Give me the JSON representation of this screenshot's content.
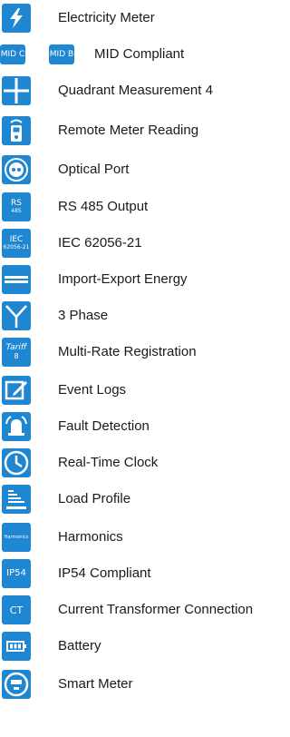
{
  "features": [
    {
      "label": "Electricity Meter",
      "icon": "lightning-icon"
    },
    {
      "label": "MID Compliant",
      "icon": "mid-badge-icon",
      "badges": [
        "MID C",
        "MID B"
      ]
    },
    {
      "label": "Quadrant Measurement 4",
      "icon": "quadrant-icon"
    },
    {
      "label": "Remote Meter Reading",
      "icon": "remote-reader-icon"
    },
    {
      "label": "Optical Port",
      "icon": "optical-port-icon"
    },
    {
      "label": "RS 485 Output",
      "icon": "rs485-icon",
      "badge": [
        "RS",
        "485"
      ]
    },
    {
      "label": "IEC 62056-21",
      "icon": "iec-icon",
      "badge": [
        "IEC",
        "62056-21"
      ]
    },
    {
      "label": "Import-Export Energy",
      "icon": "import-export-icon"
    },
    {
      "label": "3 Phase",
      "icon": "three-phase-icon"
    },
    {
      "label": "Multi-Rate Registration",
      "icon": "tariff-icon",
      "badge": [
        "Tariff",
        "8"
      ]
    },
    {
      "label": "Event Logs",
      "icon": "edit-log-icon"
    },
    {
      "label": "Fault Detection",
      "icon": "alarm-bell-icon"
    },
    {
      "label": "Real-Time Clock",
      "icon": "clock-icon"
    },
    {
      "label": "Load Profile",
      "icon": "load-profile-icon"
    },
    {
      "label": "Harmonics",
      "icon": "harmonics-icon",
      "badge": [
        "Harmonics"
      ]
    },
    {
      "label": "IP54 Compliant",
      "icon": "ip54-icon",
      "badge": [
        "IP54"
      ]
    },
    {
      "label": "Current Transformer Connection",
      "icon": "ct-icon",
      "badge": [
        "CT"
      ]
    },
    {
      "label": "Battery",
      "icon": "battery-icon"
    },
    {
      "label": "Smart Meter",
      "icon": "smart-meter-icon"
    }
  ],
  "colors": {
    "icon_bg": "#1f86d1",
    "text": "#1a1a1a",
    "background": "#ffffff"
  }
}
